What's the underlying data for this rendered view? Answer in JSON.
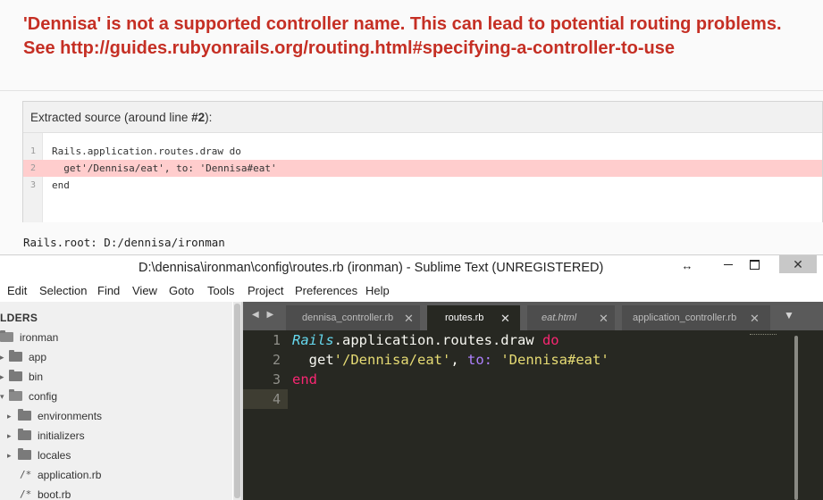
{
  "rails_error": {
    "title": "'Dennisa' is not a supported controller name. This can lead to potential routing problems. See http://guides.rubyonrails.org/routing.html#specifying-a-controller-to-use",
    "extracted_prefix": "Extracted source (around line ",
    "extracted_line": "#2",
    "extracted_suffix": "):",
    "source_lines": [
      {
        "num": "1",
        "text": "Rails.application.routes.draw do",
        "highlighted": false
      },
      {
        "num": "2",
        "text": "  get'/Dennisa/eat', to: 'Dennisa#eat'",
        "highlighted": true
      },
      {
        "num": "3",
        "text": "end",
        "highlighted": false
      }
    ],
    "rails_root": "Rails.root: D:/dennisa/ironman",
    "highlight_color": "#ffcdcd",
    "title_color": "#c52f24"
  },
  "window": {
    "title": "D:\\dennisa\\ironman\\config\\routes.rb (ironman) - Sublime Text (UNREGISTERED)",
    "resize_glyph": "↔",
    "close_glyph": "✕"
  },
  "menu": [
    "Edit",
    "Selection",
    "Find",
    "View",
    "Goto",
    "Tools",
    "Project",
    "Preferences",
    "Help"
  ],
  "sidebar": {
    "header": "LDERS",
    "items": [
      {
        "label": "ironman",
        "type": "folder-open",
        "arrow": "▾"
      },
      {
        "label": "app",
        "type": "folder",
        "arrow": "▸"
      },
      {
        "label": "bin",
        "type": "folder",
        "arrow": "▸"
      },
      {
        "label": "config",
        "type": "folder-open",
        "arrow": "▾"
      },
      {
        "label": "environments",
        "type": "folder",
        "arrow": "▸"
      },
      {
        "label": "initializers",
        "type": "folder",
        "arrow": "▸"
      },
      {
        "label": "locales",
        "type": "folder",
        "arrow": "▸"
      },
      {
        "label": "application.rb",
        "type": "file",
        "icon": "/*"
      },
      {
        "label": "boot.rb",
        "type": "file",
        "icon": "/*"
      }
    ]
  },
  "tabs": [
    {
      "label": "dennisa_controller.rb",
      "close": "✕",
      "active": false,
      "italic": false
    },
    {
      "label": "routes.rb",
      "close": "✕",
      "active": true,
      "italic": false
    },
    {
      "label": "eat.html",
      "close": "✕",
      "active": false,
      "italic": true
    },
    {
      "label": "application_controller.rb",
      "close": "✕",
      "active": false,
      "italic": false
    }
  ],
  "tab_nav": "◀ ▶",
  "tab_menu": "▼",
  "editor": {
    "line_numbers": [
      "1",
      "2",
      "3",
      "4"
    ],
    "line1": {
      "const": "Rails",
      "rest": ".application.routes.draw ",
      "kw": "do"
    },
    "line2": {
      "indent": "  get",
      "str1": "'/Dennisa/eat'",
      "comma": ", ",
      "sym": "to:",
      "space": " ",
      "str2": "'Dennisa#eat'"
    },
    "line3": {
      "kw": "end"
    },
    "theme": {
      "background": "#272822",
      "keyword": "#f92672",
      "string": "#e6db74",
      "constant": "#66d9ef",
      "symbol": "#ae81ff"
    }
  }
}
